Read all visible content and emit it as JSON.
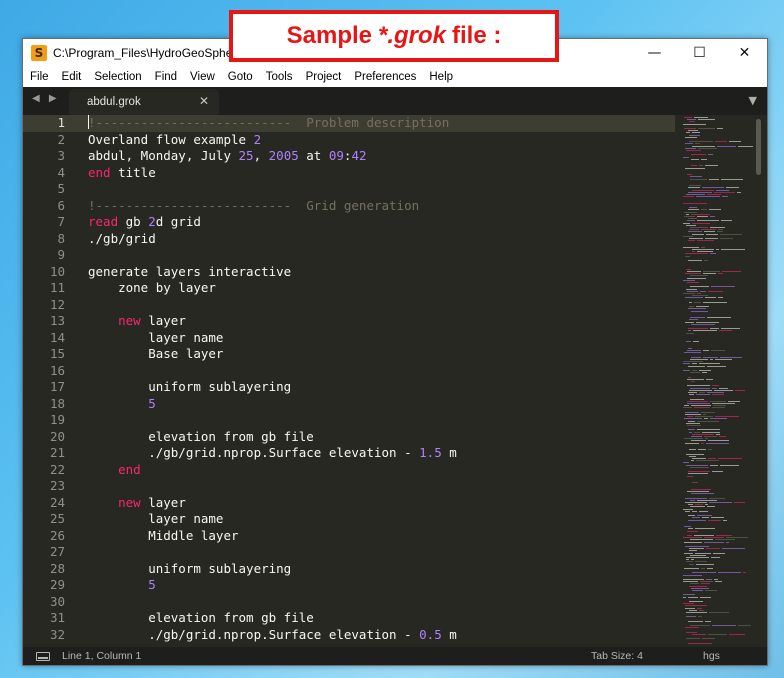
{
  "window": {
    "title": "C:\\Program_Files\\HydroGeoSphere\\abdul.grok - Sublime Text",
    "controls": {
      "minimize": "—",
      "maximize": "☐",
      "close": "✕"
    }
  },
  "menu": [
    "File",
    "Edit",
    "Selection",
    "Find",
    "View",
    "Goto",
    "Tools",
    "Project",
    "Preferences",
    "Help"
  ],
  "tabs": {
    "nav_arrows": "◀ ▶",
    "active_tab": "abdul.grok",
    "close_glyph": "✕",
    "dropdown_glyph": "▼"
  },
  "banner": {
    "prefix": "Sample",
    "italic": "*.grok",
    "suffix": "file :"
  },
  "editor": {
    "active_line": 1,
    "lines": [
      [
        {
          "t": "!--------------------------  Problem description",
          "c": "comment"
        }
      ],
      [
        {
          "t": "Overland flow example ",
          "c": "text"
        },
        {
          "t": "2",
          "c": "number"
        }
      ],
      [
        {
          "t": "abdul, Monday, July ",
          "c": "text"
        },
        {
          "t": "25",
          "c": "number"
        },
        {
          "t": ", ",
          "c": "text"
        },
        {
          "t": "2005",
          "c": "number"
        },
        {
          "t": " at ",
          "c": "text"
        },
        {
          "t": "09",
          "c": "number"
        },
        {
          "t": ":",
          "c": "text"
        },
        {
          "t": "42",
          "c": "number"
        }
      ],
      [
        {
          "t": "end",
          "c": "keyword"
        },
        {
          "t": " title",
          "c": "text"
        }
      ],
      [],
      [
        {
          "t": "!--------------------------  Grid generation",
          "c": "comment"
        }
      ],
      [
        {
          "t": "read",
          "c": "keyword"
        },
        {
          "t": " gb ",
          "c": "text"
        },
        {
          "t": "2",
          "c": "number"
        },
        {
          "t": "d grid",
          "c": "text"
        }
      ],
      [
        {
          "t": "./gb/grid",
          "c": "text"
        }
      ],
      [],
      [
        {
          "t": "generate layers interactive",
          "c": "text"
        }
      ],
      [
        {
          "t": "    zone by layer",
          "c": "text"
        }
      ],
      [],
      [
        {
          "t": "    ",
          "c": "text"
        },
        {
          "t": "new",
          "c": "keyword"
        },
        {
          "t": " layer",
          "c": "text"
        }
      ],
      [
        {
          "t": "        layer name",
          "c": "text"
        }
      ],
      [
        {
          "t": "        Base layer",
          "c": "text"
        }
      ],
      [],
      [
        {
          "t": "        uniform sublayering",
          "c": "text"
        }
      ],
      [
        {
          "t": "        ",
          "c": "text"
        },
        {
          "t": "5",
          "c": "number"
        }
      ],
      [],
      [
        {
          "t": "        elevation from gb file",
          "c": "text"
        }
      ],
      [
        {
          "t": "        ./gb/grid.nprop.Surface elevation - ",
          "c": "text"
        },
        {
          "t": "1.5",
          "c": "number"
        },
        {
          "t": " m",
          "c": "text"
        }
      ],
      [
        {
          "t": "    ",
          "c": "text"
        },
        {
          "t": "end",
          "c": "keyword"
        }
      ],
      [],
      [
        {
          "t": "    ",
          "c": "text"
        },
        {
          "t": "new",
          "c": "keyword"
        },
        {
          "t": " layer",
          "c": "text"
        }
      ],
      [
        {
          "t": "        layer name",
          "c": "text"
        }
      ],
      [
        {
          "t": "        Middle layer",
          "c": "text"
        }
      ],
      [],
      [
        {
          "t": "        uniform sublayering",
          "c": "text"
        }
      ],
      [
        {
          "t": "        ",
          "c": "text"
        },
        {
          "t": "5",
          "c": "number"
        }
      ],
      [],
      [
        {
          "t": "        elevation from gb file",
          "c": "text"
        }
      ],
      [
        {
          "t": "        ./gb/grid.nprop.Surface elevation - ",
          "c": "text"
        },
        {
          "t": "0.5",
          "c": "number"
        },
        {
          "t": " m",
          "c": "text"
        }
      ]
    ]
  },
  "status": {
    "position": "Line 1, Column 1",
    "tab_size": "Tab Size: 4",
    "syntax": "hgs"
  },
  "colors": {
    "background": "#272822",
    "comment": "#75715e",
    "keyword": "#f92672",
    "number": "#ae81ff",
    "text": "#f8f8f2",
    "banner_red": "#e81515"
  }
}
